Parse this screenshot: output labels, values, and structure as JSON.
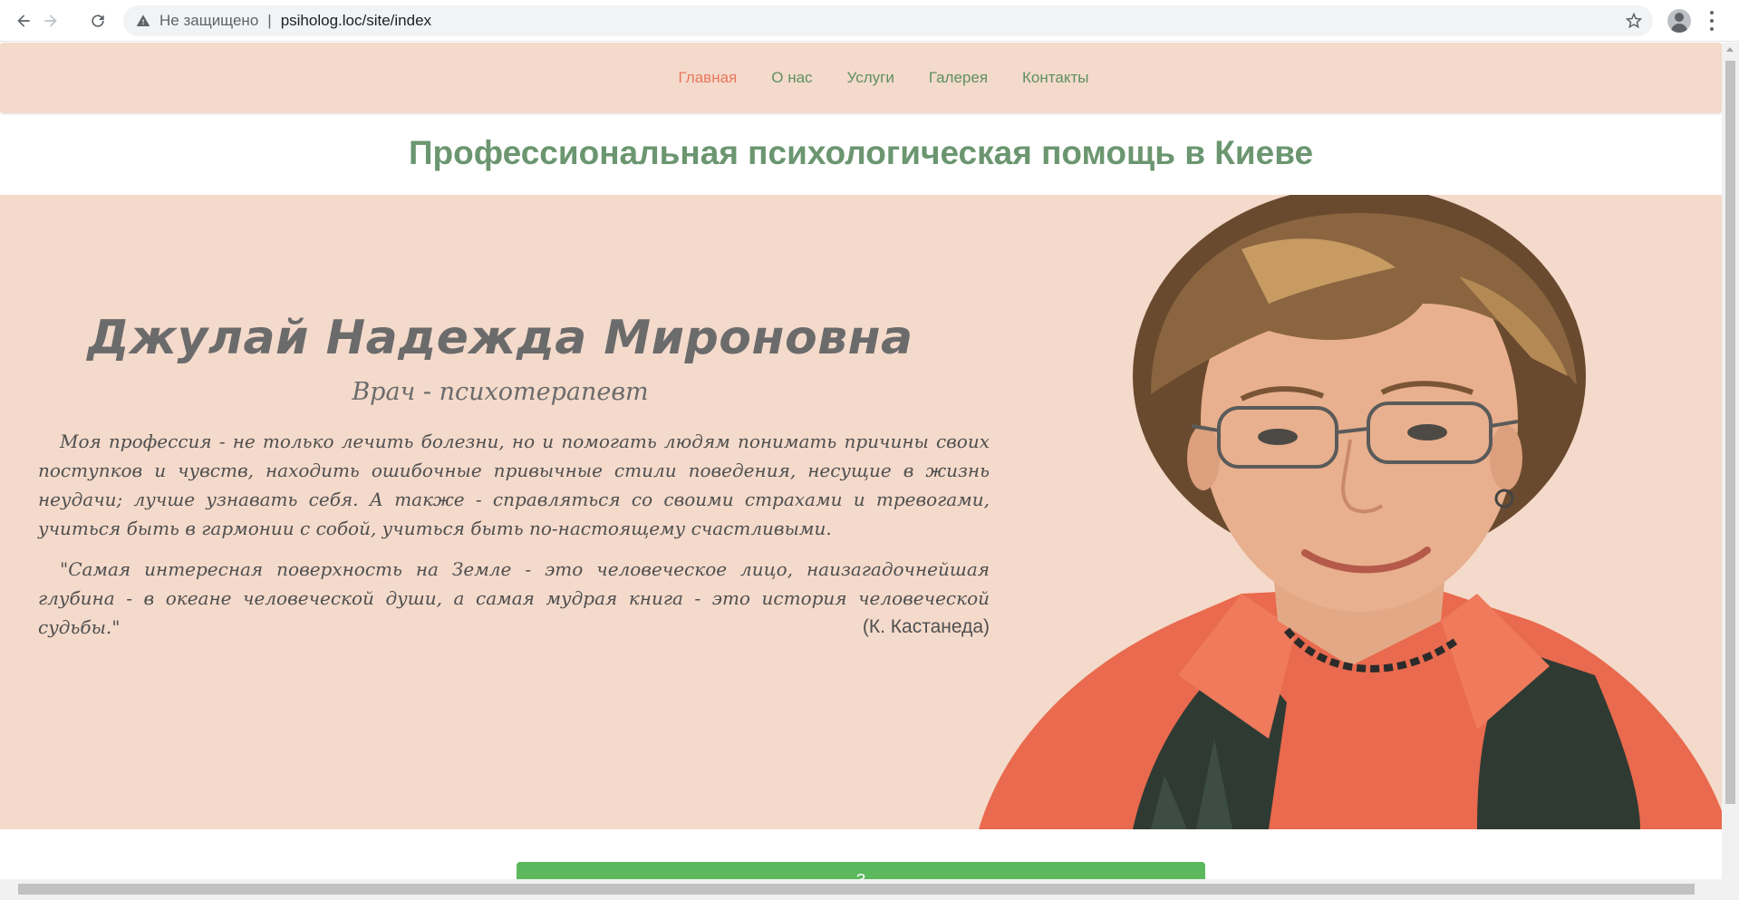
{
  "browser": {
    "security_label": "Не защищено",
    "separator": "|",
    "url": "psiholog.loc/site/index"
  },
  "nav": {
    "items": [
      {
        "label": "Главная",
        "active": true
      },
      {
        "label": "О нас"
      },
      {
        "label": "Услуги"
      },
      {
        "label": "Галерея"
      },
      {
        "label": "Контакты"
      }
    ]
  },
  "headline": "Профессиональная психологическая помощь в Киеве",
  "hero": {
    "name": "Джулай Надежда Мироновна",
    "role": "Врач - психотерапевт",
    "paragraph": "Моя профессия - не только лечить болезни, но и помогать людям понимать причины своих поступков и чувств, находить ошибочные привычные стили поведения, несущие в жизнь неудачи; лучше узнавать себя. А также - справляться со своими страхами и тревогами, учиться быть в гармонии с собой, учиться быть по-настоящему счастливыми.",
    "quote": "\"Самая интересная поверхность на Земле - это человеческое лицо, наизагадочнейшая глубина - в океане человеческой души, а самая мудрая книга - это история человеческой судьбы.\"",
    "quote_author": "(К. Кастанеда)"
  },
  "cta": {
    "label": "З"
  },
  "colors": {
    "nav_bg": "#f4dacb",
    "nav_link": "#5e8f63",
    "nav_active": "#e8775e",
    "headline": "#6b9670",
    "hero_bg": "#f4dacb",
    "cta_bg": "#5cb85c"
  },
  "icons": [
    "back-arrow-icon",
    "forward-arrow-icon",
    "reload-icon",
    "warning-icon",
    "star-icon",
    "profile-icon",
    "menu-dots-icon"
  ]
}
